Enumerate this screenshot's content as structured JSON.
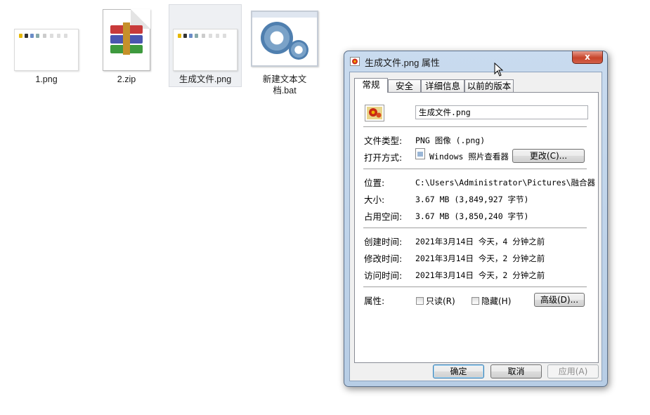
{
  "desktop": {
    "files": [
      {
        "name": "1.png"
      },
      {
        "name": "2.zip"
      },
      {
        "name": "生成文件.png"
      },
      {
        "name": "新建文本文档.bat"
      }
    ]
  },
  "dialog": {
    "title": "生成文件.png 属性",
    "close_glyph": "x",
    "tabs": [
      "常规",
      "安全",
      "详细信息",
      "以前的版本"
    ],
    "active_tab": "常规",
    "file_name": "生成文件.png",
    "type_label": "文件类型:",
    "type_value": "PNG 图像 (.png)",
    "opens_label": "打开方式:",
    "opens_value": "Windows 照片查看器",
    "change_button": "更改(C)...",
    "location_label": "位置:",
    "location_value": "C:\\Users\\Administrator\\Pictures\\融合器",
    "size_label": "大小:",
    "size_value": "3.67 MB (3,849,927 字节)",
    "disk_label": "占用空间:",
    "disk_value": "3.67 MB (3,850,240 字节)",
    "created_label": "创建时间:",
    "created_value": "2021年3月14日 今天，4 分钟之前",
    "modified_label": "修改时间:",
    "modified_value": "2021年3月14日 今天，2 分钟之前",
    "accessed_label": "访问时间:",
    "accessed_value": "2021年3月14日 今天，2 分钟之前",
    "attributes_label": "属性:",
    "readonly_label": "只读(R)",
    "readonly_checked": false,
    "hidden_label": "隐藏(H)",
    "hidden_checked": false,
    "advanced_button": "高级(D)...",
    "ok_button": "确定",
    "cancel_button": "取消",
    "apply_button": "应用(A)"
  },
  "colors": {
    "window_frame": "#b7cde5",
    "close_button": "#c7442a",
    "selection": "#eef0f3"
  }
}
